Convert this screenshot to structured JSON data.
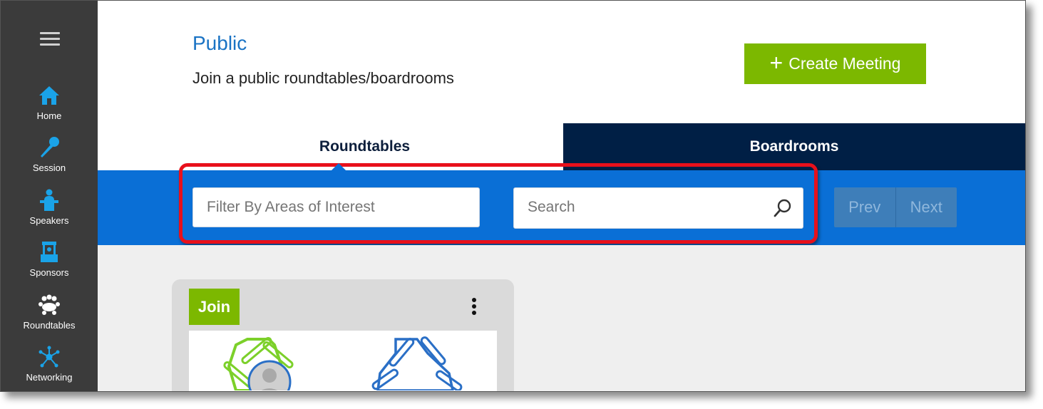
{
  "sidebar": {
    "items": [
      {
        "label": "Home",
        "icon": "home-icon"
      },
      {
        "label": "Session",
        "icon": "microphone-icon"
      },
      {
        "label": "Speakers",
        "icon": "podium-icon"
      },
      {
        "label": "Sponsors",
        "icon": "booth-icon"
      },
      {
        "label": "Roundtables",
        "icon": "group-icon"
      },
      {
        "label": "Networking",
        "icon": "network-icon"
      }
    ]
  },
  "header": {
    "title": "Public",
    "subtitle": "Join a public roundtables/boardrooms",
    "create_label": "Create Meeting"
  },
  "tabs": [
    {
      "label": "Roundtables",
      "active": true
    },
    {
      "label": "Boardrooms",
      "active": false
    }
  ],
  "filters": {
    "interest_placeholder": "Filter By Areas of Interest",
    "search_placeholder": "Search"
  },
  "pager": {
    "prev": "Prev",
    "next": "Next"
  },
  "card": {
    "join_label": "Join"
  },
  "colors": {
    "sidebar": "#3b3b3b",
    "accent_green": "#7cb800",
    "accent_blue": "#0a6fd6",
    "dark_navy": "#001f45",
    "icon_blue": "#1aa3e8",
    "title_blue": "#1a73c4",
    "highlight_red": "#e8101b"
  }
}
